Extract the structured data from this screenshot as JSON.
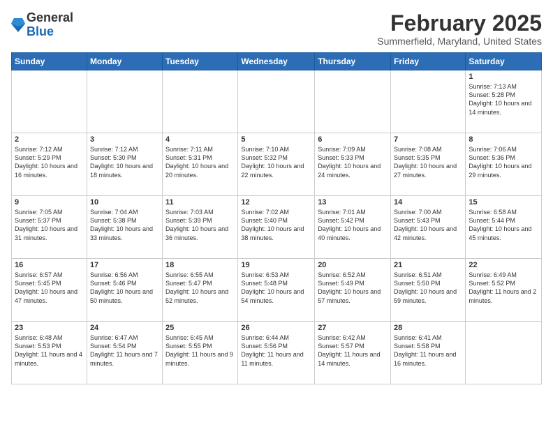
{
  "logo": {
    "general": "General",
    "blue": "Blue"
  },
  "header": {
    "month": "February 2025",
    "location": "Summerfield, Maryland, United States"
  },
  "weekdays": [
    "Sunday",
    "Monday",
    "Tuesday",
    "Wednesday",
    "Thursday",
    "Friday",
    "Saturday"
  ],
  "weeks": [
    [
      {
        "day": "",
        "info": ""
      },
      {
        "day": "",
        "info": ""
      },
      {
        "day": "",
        "info": ""
      },
      {
        "day": "",
        "info": ""
      },
      {
        "day": "",
        "info": ""
      },
      {
        "day": "",
        "info": ""
      },
      {
        "day": "1",
        "info": "Sunrise: 7:13 AM\nSunset: 5:28 PM\nDaylight: 10 hours and 14 minutes."
      }
    ],
    [
      {
        "day": "2",
        "info": "Sunrise: 7:12 AM\nSunset: 5:29 PM\nDaylight: 10 hours and 16 minutes."
      },
      {
        "day": "3",
        "info": "Sunrise: 7:12 AM\nSunset: 5:30 PM\nDaylight: 10 hours and 18 minutes."
      },
      {
        "day": "4",
        "info": "Sunrise: 7:11 AM\nSunset: 5:31 PM\nDaylight: 10 hours and 20 minutes."
      },
      {
        "day": "5",
        "info": "Sunrise: 7:10 AM\nSunset: 5:32 PM\nDaylight: 10 hours and 22 minutes."
      },
      {
        "day": "6",
        "info": "Sunrise: 7:09 AM\nSunset: 5:33 PM\nDaylight: 10 hours and 24 minutes."
      },
      {
        "day": "7",
        "info": "Sunrise: 7:08 AM\nSunset: 5:35 PM\nDaylight: 10 hours and 27 minutes."
      },
      {
        "day": "8",
        "info": "Sunrise: 7:06 AM\nSunset: 5:36 PM\nDaylight: 10 hours and 29 minutes."
      }
    ],
    [
      {
        "day": "9",
        "info": "Sunrise: 7:05 AM\nSunset: 5:37 PM\nDaylight: 10 hours and 31 minutes."
      },
      {
        "day": "10",
        "info": "Sunrise: 7:04 AM\nSunset: 5:38 PM\nDaylight: 10 hours and 33 minutes."
      },
      {
        "day": "11",
        "info": "Sunrise: 7:03 AM\nSunset: 5:39 PM\nDaylight: 10 hours and 36 minutes."
      },
      {
        "day": "12",
        "info": "Sunrise: 7:02 AM\nSunset: 5:40 PM\nDaylight: 10 hours and 38 minutes."
      },
      {
        "day": "13",
        "info": "Sunrise: 7:01 AM\nSunset: 5:42 PM\nDaylight: 10 hours and 40 minutes."
      },
      {
        "day": "14",
        "info": "Sunrise: 7:00 AM\nSunset: 5:43 PM\nDaylight: 10 hours and 42 minutes."
      },
      {
        "day": "15",
        "info": "Sunrise: 6:58 AM\nSunset: 5:44 PM\nDaylight: 10 hours and 45 minutes."
      }
    ],
    [
      {
        "day": "16",
        "info": "Sunrise: 6:57 AM\nSunset: 5:45 PM\nDaylight: 10 hours and 47 minutes."
      },
      {
        "day": "17",
        "info": "Sunrise: 6:56 AM\nSunset: 5:46 PM\nDaylight: 10 hours and 50 minutes."
      },
      {
        "day": "18",
        "info": "Sunrise: 6:55 AM\nSunset: 5:47 PM\nDaylight: 10 hours and 52 minutes."
      },
      {
        "day": "19",
        "info": "Sunrise: 6:53 AM\nSunset: 5:48 PM\nDaylight: 10 hours and 54 minutes."
      },
      {
        "day": "20",
        "info": "Sunrise: 6:52 AM\nSunset: 5:49 PM\nDaylight: 10 hours and 57 minutes."
      },
      {
        "day": "21",
        "info": "Sunrise: 6:51 AM\nSunset: 5:50 PM\nDaylight: 10 hours and 59 minutes."
      },
      {
        "day": "22",
        "info": "Sunrise: 6:49 AM\nSunset: 5:52 PM\nDaylight: 11 hours and 2 minutes."
      }
    ],
    [
      {
        "day": "23",
        "info": "Sunrise: 6:48 AM\nSunset: 5:53 PM\nDaylight: 11 hours and 4 minutes."
      },
      {
        "day": "24",
        "info": "Sunrise: 6:47 AM\nSunset: 5:54 PM\nDaylight: 11 hours and 7 minutes."
      },
      {
        "day": "25",
        "info": "Sunrise: 6:45 AM\nSunset: 5:55 PM\nDaylight: 11 hours and 9 minutes."
      },
      {
        "day": "26",
        "info": "Sunrise: 6:44 AM\nSunset: 5:56 PM\nDaylight: 11 hours and 11 minutes."
      },
      {
        "day": "27",
        "info": "Sunrise: 6:42 AM\nSunset: 5:57 PM\nDaylight: 11 hours and 14 minutes."
      },
      {
        "day": "28",
        "info": "Sunrise: 6:41 AM\nSunset: 5:58 PM\nDaylight: 11 hours and 16 minutes."
      },
      {
        "day": "",
        "info": ""
      }
    ]
  ]
}
